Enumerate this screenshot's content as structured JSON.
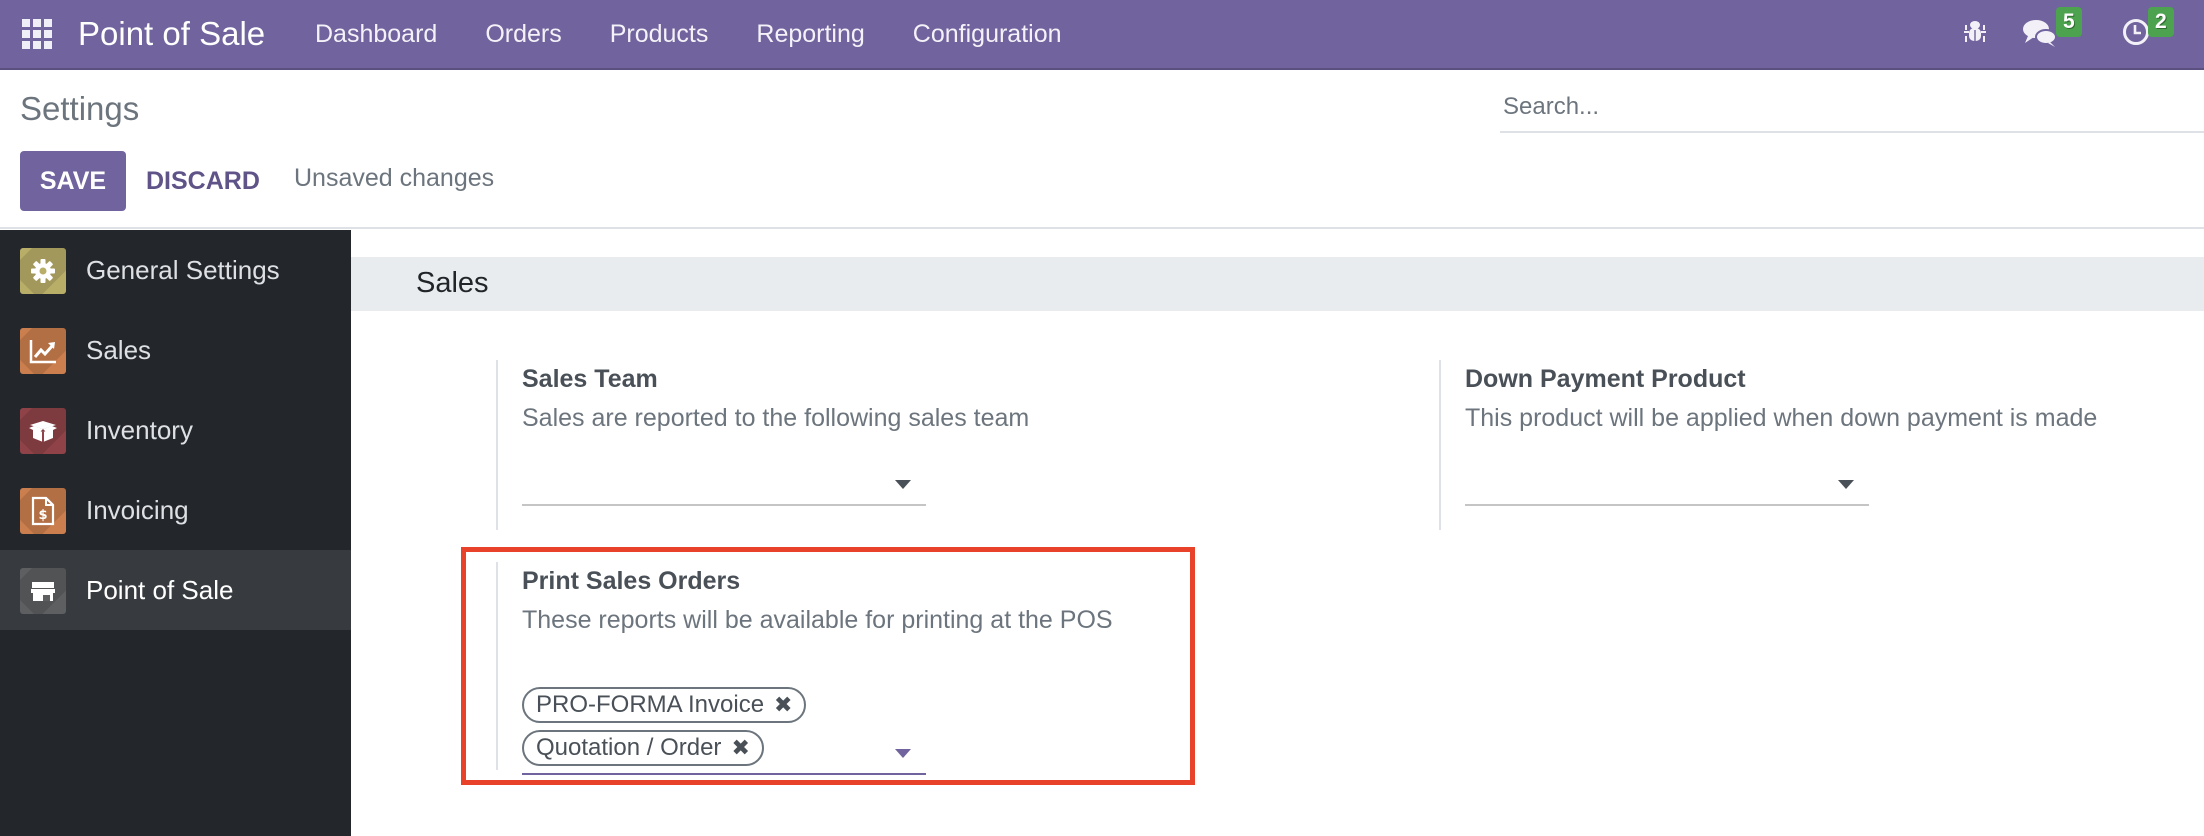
{
  "navbar": {
    "app_title": "Point of Sale",
    "menu": [
      "Dashboard",
      "Orders",
      "Products",
      "Reporting",
      "Configuration"
    ],
    "systray": {
      "debug_icon": "bug-icon",
      "messages_icon": "chat-bubbles-icon",
      "messages_count": "5",
      "activities_icon": "clock-icon",
      "activities_count": "2"
    },
    "accent_color": "#71639e"
  },
  "control_panel": {
    "breadcrumb": "Settings",
    "search_placeholder": "Search...",
    "save_label": "SAVE",
    "discard_label": "DISCARD",
    "status_text": "Unsaved changes"
  },
  "sidebar": {
    "items": [
      {
        "label": "General Settings",
        "icon": "gear-icon",
        "color": "#b9ae68",
        "active": false
      },
      {
        "label": "Sales",
        "icon": "chart-trend-icon",
        "color": "#cc7f4e",
        "active": false
      },
      {
        "label": "Inventory",
        "icon": "box-icon",
        "color": "#8f4348",
        "active": false
      },
      {
        "label": "Invoicing",
        "icon": "invoice-dollar-icon",
        "color": "#cc7f4e",
        "active": false
      },
      {
        "label": "Point of Sale",
        "icon": "store-icon",
        "color": "#5d5f61",
        "active": true
      }
    ]
  },
  "main": {
    "section_title": "Sales",
    "settings": [
      {
        "label": "Sales Team",
        "description": "Sales are reported to the following sales team",
        "value": ""
      },
      {
        "label": "Down Payment Product",
        "description": "This product will be applied when down payment is made",
        "value": ""
      },
      {
        "label": "Print Sales Orders",
        "description": "These reports will be available for printing at the POS",
        "tags": [
          "PRO-FORMA Invoice",
          "Quotation / Order"
        ],
        "highlighted": true
      }
    ],
    "highlight_color": "#e8432a"
  }
}
